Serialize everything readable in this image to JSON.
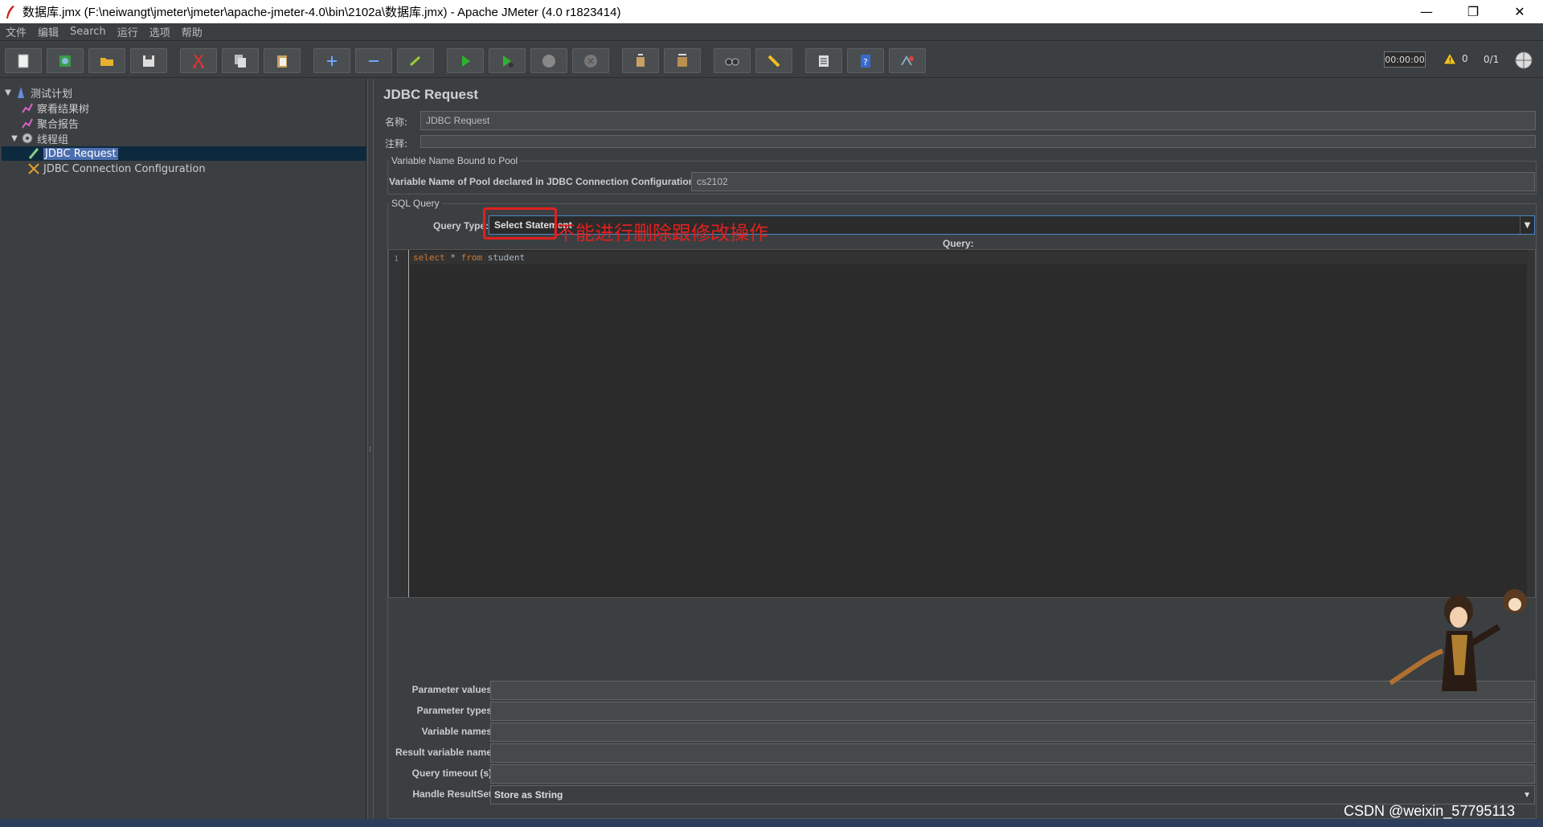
{
  "window": {
    "title": "数据库.jmx (F:\\neiwangt\\jmeter\\jmeter\\apache-jmeter-4.0\\bin\\2102a\\数据库.jmx) - Apache JMeter (4.0 r1823414)",
    "minimize": "—",
    "restore": "❐",
    "close": "✕"
  },
  "menu": [
    "文件",
    "编辑",
    "Search",
    "运行",
    "选项",
    "帮助"
  ],
  "toolbar": {
    "timer": "00:00:00",
    "warnings": "0",
    "threads": "0/1",
    "icons": [
      "new-icon",
      "templates-icon",
      "open-icon",
      "save-icon",
      "cut-icon",
      "copy-icon",
      "paste-icon",
      "expand-icon",
      "collapse-icon",
      "toggle-icon",
      "start-icon",
      "start-no-pause-icon",
      "stop-icon",
      "shutdown-icon",
      "clear-icon",
      "clear-all-icon",
      "search-icon",
      "reset-search-icon",
      "function-helper-icon",
      "help-icon",
      "remote-icon"
    ]
  },
  "tree": {
    "items": [
      {
        "label": "测试计划",
        "icon": "test-plan-icon",
        "expanded": true
      },
      {
        "label": "察看结果树",
        "icon": "listener-icon"
      },
      {
        "label": "聚合报告",
        "icon": "listener-icon"
      },
      {
        "label": "线程组",
        "icon": "thread-group-icon",
        "expanded": true
      },
      {
        "label": "JDBC Request",
        "icon": "sampler-icon",
        "selected": true
      },
      {
        "label": "JDBC Connection Configuration",
        "icon": "config-icon"
      }
    ]
  },
  "panel": {
    "title": "JDBC Request",
    "name_label": "名称:",
    "name_value": "JDBC Request",
    "comment_label": "注释:",
    "comment_value": "",
    "pool_group_title": "Variable Name Bound to Pool",
    "pool_label": "Variable Name of Pool declared in JDBC Connection Configuration:",
    "pool_value": "cs2102",
    "sql_group_title": "SQL Query",
    "query_type_label": "Query Type:",
    "query_type_value": "Select Statement",
    "query_label": "Query:",
    "query_line_number": "1",
    "query_code": {
      "kw1": "select",
      "mid": " * ",
      "kw2": "from",
      "rest": " student"
    },
    "annotation": "不能进行删除跟修改操作",
    "params": [
      {
        "label": "Parameter values:",
        "value": ""
      },
      {
        "label": "Parameter types:",
        "value": ""
      },
      {
        "label": "Variable names:",
        "value": ""
      },
      {
        "label": "Result variable name:",
        "value": ""
      },
      {
        "label": "Query timeout (s):",
        "value": ""
      },
      {
        "label": "Handle ResultSet:",
        "value": "Store as String"
      }
    ]
  },
  "watermark": "CSDN @weixin_57795113",
  "colors": {
    "highlight": "#e02020",
    "selection": "#4b6eaf",
    "background": "#3c3f41"
  }
}
